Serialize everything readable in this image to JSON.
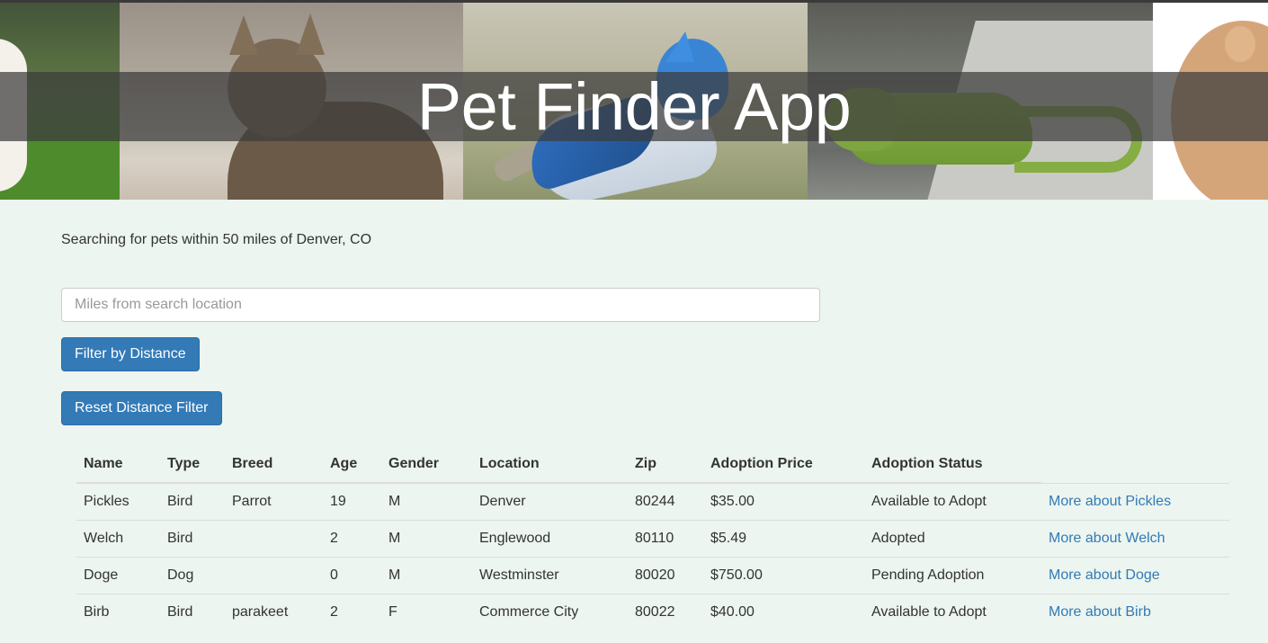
{
  "header": {
    "title": "Pet Finder App"
  },
  "search": {
    "info": "Searching for pets within 50 miles of Denver, CO",
    "miles_placeholder": "Miles from search location",
    "filter_button": "Filter by Distance",
    "reset_button": "Reset Distance Filter"
  },
  "table": {
    "headers": {
      "name": "Name",
      "type": "Type",
      "breed": "Breed",
      "age": "Age",
      "gender": "Gender",
      "location": "Location",
      "zip": "Zip",
      "price": "Adoption Price",
      "status": "Adoption Status"
    },
    "rows": [
      {
        "name": "Pickles",
        "type": "Bird",
        "breed": "Parrot",
        "age": "19",
        "gender": "M",
        "location": "Denver",
        "zip": "80244",
        "price": "$35.00",
        "status": "Available to Adopt",
        "link": "More about Pickles"
      },
      {
        "name": "Welch",
        "type": "Bird",
        "breed": "",
        "age": "2",
        "gender": "M",
        "location": "Englewood",
        "zip": "80110",
        "price": "$5.49",
        "status": "Adopted",
        "link": "More about Welch"
      },
      {
        "name": "Doge",
        "type": "Dog",
        "breed": "",
        "age": "0",
        "gender": "M",
        "location": "Westminster",
        "zip": "80020",
        "price": "$750.00",
        "status": "Pending Adoption",
        "link": "More about Doge"
      },
      {
        "name": "Birb",
        "type": "Bird",
        "breed": "parakeet",
        "age": "2",
        "gender": "F",
        "location": "Commerce City",
        "zip": "80022",
        "price": "$40.00",
        "status": "Available to Adopt",
        "link": "More about Birb"
      }
    ]
  },
  "colors": {
    "page_background": "#ecf5ef",
    "primary_button": "#337ab7",
    "link": "#337ab7"
  }
}
